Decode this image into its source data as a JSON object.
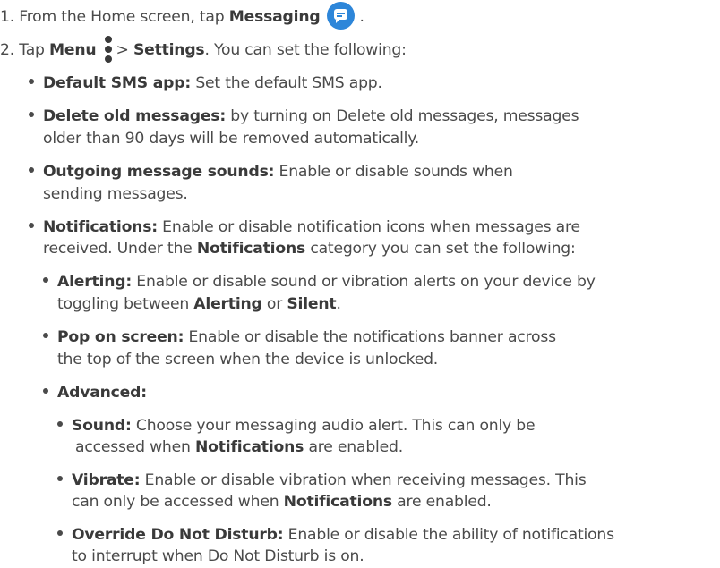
{
  "step1": {
    "prefix": "1. From the Home screen, tap ",
    "bold": "Messaging",
    "suffix": " ."
  },
  "step2": {
    "prefix": "2. Tap ",
    "bold_menu": "Menu",
    "gt": " > ",
    "bold_settings": "Settings",
    "suffix": ". You can set the following:"
  },
  "items": {
    "default_sms": {
      "label": "Default SMS app:",
      "text": " Set the default SMS app."
    },
    "delete_old": {
      "label": "Delete old messages:",
      "text": " by turning on Delete old messages, messages",
      "text2": "older than 90 days will be removed automatically."
    },
    "outgoing": {
      "label": "Outgoing message sounds:",
      "text": " Enable or disable sounds when",
      "text2": "sending messages."
    },
    "notifications": {
      "label": "Notifications:",
      "text": " Enable or disable notification icons when messages are",
      "text2a": "received. Under the ",
      "text2b": "Notifications",
      "text2c": " category you can set the following:"
    },
    "alerting": {
      "label": "Alerting:",
      "text": " Enable or disable sound or vibration alerts on your device by",
      "text2a": "toggling between ",
      "text2b": "Alerting",
      "text2c": " or ",
      "text2d": "Silent",
      "text2e": "."
    },
    "pop": {
      "label": "Pop on screen:",
      "text": " Enable or disable the notifications banner across",
      "text2": "the top of the screen when the device is unlocked."
    },
    "advanced": {
      "label": "Advanced:"
    },
    "sound": {
      "label": "Sound:",
      "text": " Choose your messaging audio alert. This can only be",
      "text2a": "accessed when ",
      "text2b": "Notifications",
      "text2c": " are enabled."
    },
    "vibrate": {
      "label": "Vibrate:",
      "text": " Enable or disable vibration when receiving messages. This",
      "text2a": "can only be accessed when ",
      "text2b": "Notifications",
      "text2c": " are enabled."
    },
    "dnd": {
      "label": "Override Do Not Disturb:",
      "text": " Enable or disable the ability of notifications",
      "text2": "to interrupt when Do Not Disturb is on."
    }
  },
  "icons": {
    "messaging": "message-bubble-icon",
    "menu": "vertical-dots-icon",
    "accent": "#2d86d9"
  }
}
